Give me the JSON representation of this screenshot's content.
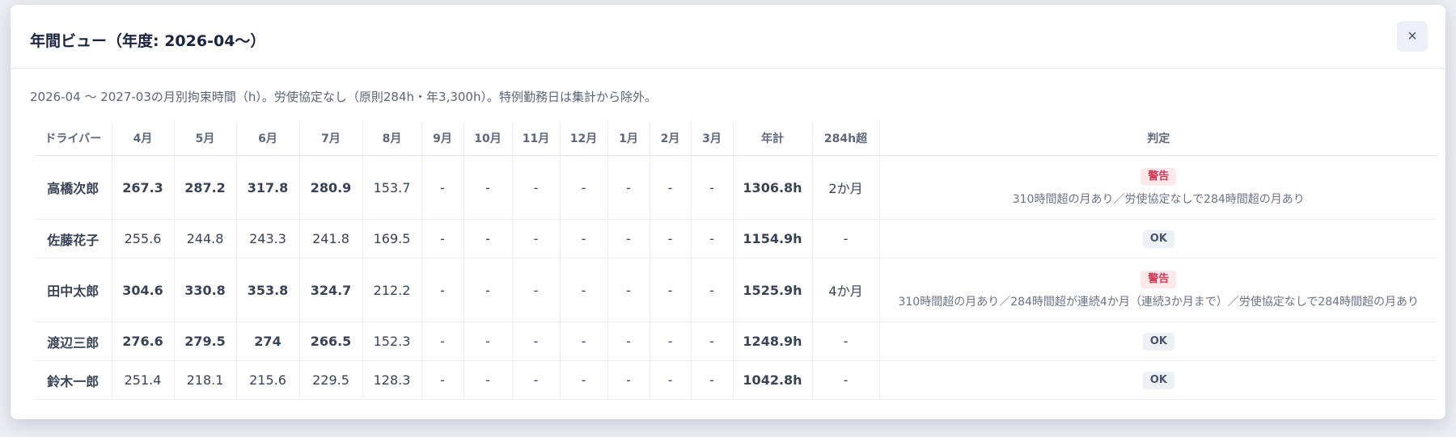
{
  "modal": {
    "title": "年間ビュー（年度: 2026-04〜）",
    "close_label": "×",
    "description": "2026-04 〜 2027-03の月別拘束時間（h）。労使協定なし（原則284h・年3,300h）。特例勤務日は集計から除外。"
  },
  "table": {
    "headers": [
      "ドライバー",
      "4月",
      "5月",
      "6月",
      "7月",
      "8月",
      "9月",
      "10月",
      "11月",
      "12月",
      "1月",
      "2月",
      "3月",
      "年計",
      "284h超",
      "判定"
    ],
    "rows": [
      {
        "driver": "高橋次郎",
        "months": [
          "267.3",
          "287.2",
          "317.8",
          "280.9",
          "153.7",
          "-",
          "-",
          "-",
          "-",
          "-",
          "-",
          "-"
        ],
        "total": "1306.8h",
        "over284": "2か月",
        "verdict_label": "警告",
        "verdict_type": "warn",
        "reason": "310時間超の月あり／労使協定なしで284時間超の月あり"
      },
      {
        "driver": "佐藤花子",
        "months": [
          "255.6",
          "244.8",
          "243.3",
          "241.8",
          "169.5",
          "-",
          "-",
          "-",
          "-",
          "-",
          "-",
          "-"
        ],
        "total": "1154.9h",
        "over284": "-",
        "verdict_label": "OK",
        "verdict_type": "ok",
        "reason": ""
      },
      {
        "driver": "田中太郎",
        "months": [
          "304.6",
          "330.8",
          "353.8",
          "324.7",
          "212.2",
          "-",
          "-",
          "-",
          "-",
          "-",
          "-",
          "-"
        ],
        "total": "1525.9h",
        "over284": "4か月",
        "verdict_label": "警告",
        "verdict_type": "warn",
        "reason": "310時間超の月あり／284時間超が連続4か月（連続3か月まで）／労使協定なしで284時間超の月あり"
      },
      {
        "driver": "渡辺三郎",
        "months": [
          "276.6",
          "279.5",
          "274",
          "266.5",
          "152.3",
          "-",
          "-",
          "-",
          "-",
          "-",
          "-",
          "-"
        ],
        "total": "1248.9h",
        "over284": "-",
        "verdict_label": "OK",
        "verdict_type": "ok",
        "reason": ""
      },
      {
        "driver": "鈴木一郎",
        "months": [
          "251.4",
          "218.1",
          "215.6",
          "229.5",
          "128.3",
          "-",
          "-",
          "-",
          "-",
          "-",
          "-",
          "-"
        ],
        "total": "1042.8h",
        "over284": "-",
        "verdict_label": "OK",
        "verdict_type": "ok",
        "reason": ""
      }
    ]
  }
}
